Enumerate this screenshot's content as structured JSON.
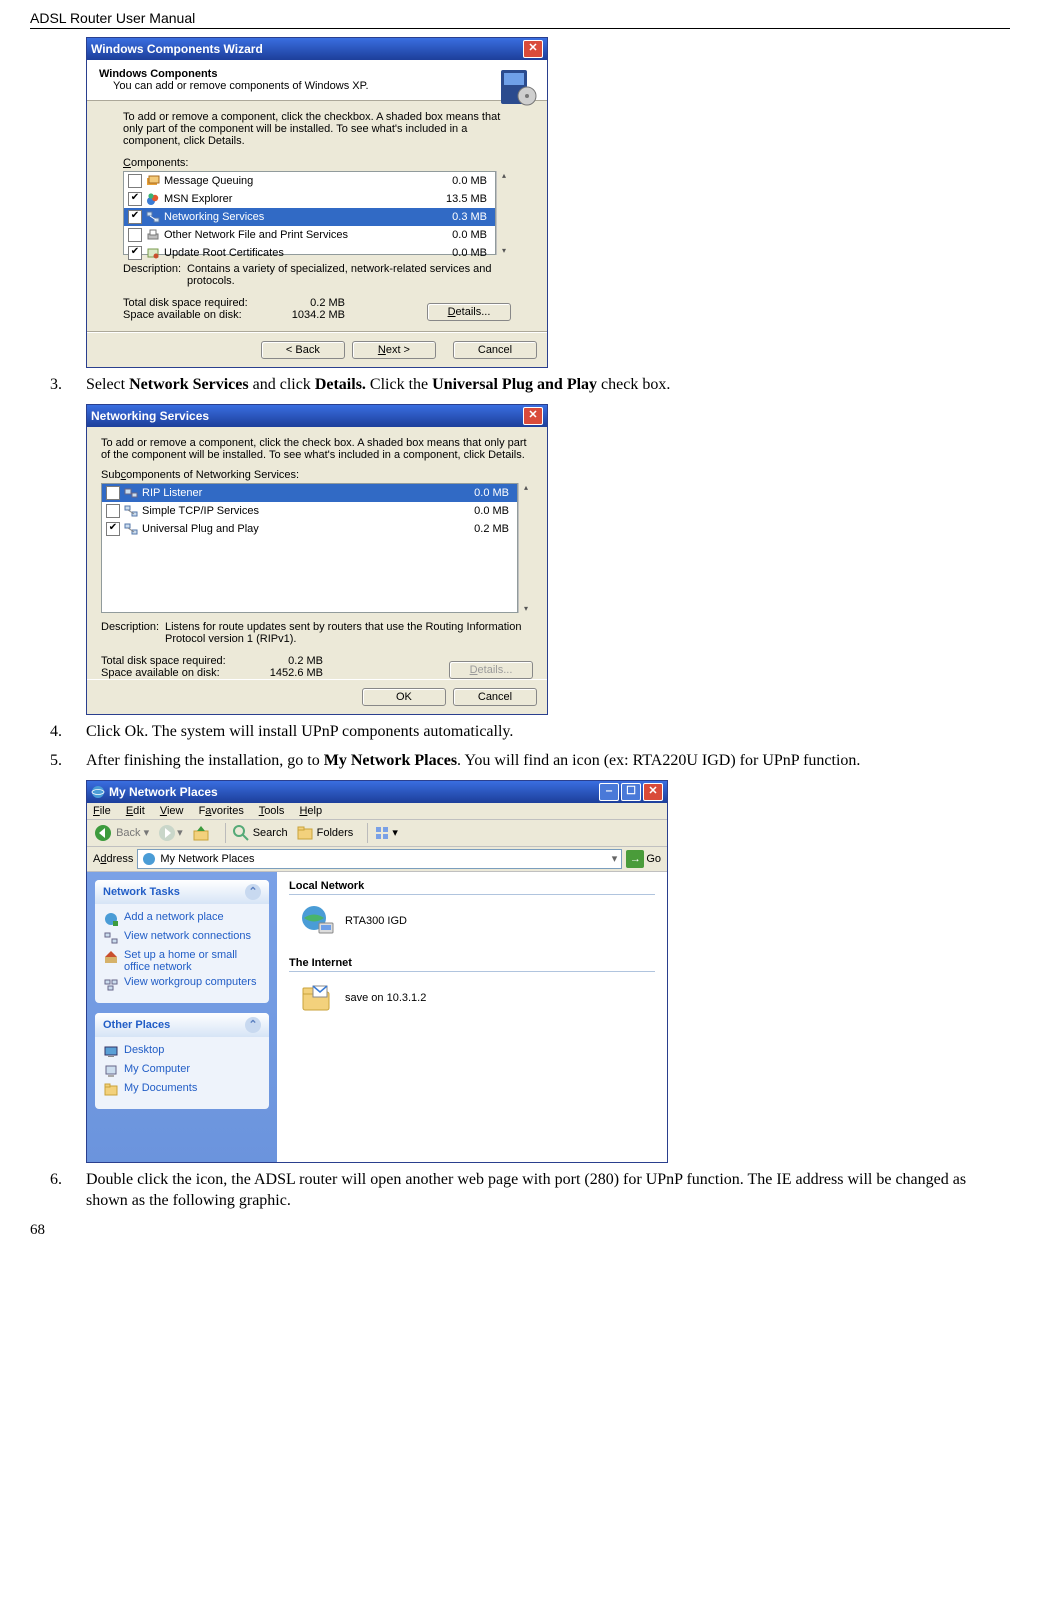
{
  "header": "ADSL Router User Manual",
  "page_number": "68",
  "steps": {
    "s3": {
      "num": "3.",
      "pre": "Select ",
      "b1": "Network Services",
      "mid": " and click ",
      "b2": "Details.",
      "post1": " Click the ",
      "b3": "Universal Plug and Play",
      "post2": " check box."
    },
    "s4": {
      "num": "4.",
      "text": "Click Ok. The system will install UPnP components automatically."
    },
    "s5": {
      "num": "5.",
      "pre": "After finishing the installation, go to ",
      "b1": "My Network Places",
      "post": ". You will find an icon (ex: RTA220U IGD) for UPnP function."
    },
    "s6": {
      "num": "6.",
      "text": "Double click the icon, the ADSL router will open another web page with port (280) for UPnP function. The IE address will be changed as shown as the following graphic."
    }
  },
  "wiz1": {
    "title": "Windows Components Wizard",
    "head_title": "Windows Components",
    "head_sub": "You can add or remove components of Windows XP.",
    "instr": "To add or remove a component, click the checkbox. A shaded box means that only part of the component will be installed. To see what's included in a component, click Details.",
    "components_label": "Components:",
    "rows": [
      {
        "checked": false,
        "label": "Message Queuing",
        "size": "0.0 MB",
        "icon": "msgq"
      },
      {
        "checked": true,
        "label": "MSN Explorer",
        "size": "13.5 MB",
        "icon": "msn"
      },
      {
        "checked": true,
        "label": "Networking Services",
        "size": "0.3 MB",
        "icon": "net",
        "selected": true
      },
      {
        "checked": false,
        "label": "Other Network File and Print Services",
        "size": "0.0 MB",
        "icon": "print"
      },
      {
        "checked": true,
        "label": "Update Root Certificates",
        "size": "0.0 MB",
        "icon": "cert"
      }
    ],
    "desc_label": "Description:",
    "desc_text": "Contains a variety of specialized, network-related services and protocols.",
    "totals": {
      "req_label": "Total disk space required:",
      "req_val": "0.2 MB",
      "avail_label": "Space available on disk:",
      "avail_val": "1034.2 MB"
    },
    "buttons": {
      "details": "Details...",
      "back": "< Back",
      "next": "Next >",
      "cancel": "Cancel"
    }
  },
  "wiz2": {
    "title": "Networking Services",
    "instr": "To add or remove a component, click the check box. A shaded box means that only part of the component will be installed. To see what's included in a component, click Details.",
    "sub_label": "Subcomponents of Networking Services:",
    "rows": [
      {
        "checked": false,
        "label": "RIP Listener",
        "size": "0.0 MB",
        "selected": true
      },
      {
        "checked": false,
        "label": "Simple TCP/IP Services",
        "size": "0.0 MB"
      },
      {
        "checked": true,
        "label": "Universal Plug and Play",
        "size": "0.2 MB"
      }
    ],
    "desc_label": "Description:",
    "desc_text": "Listens for route updates sent by routers that use the Routing Information Protocol version 1 (RIPv1).",
    "totals": {
      "req_label": "Total disk space required:",
      "req_val": "0.2 MB",
      "avail_label": "Space available on disk:",
      "avail_val": "1452.6 MB"
    },
    "buttons": {
      "details": "Details...",
      "ok": "OK",
      "cancel": "Cancel"
    }
  },
  "explorer": {
    "title": "My Network Places",
    "menus": {
      "file": "File",
      "edit": "Edit",
      "view": "View",
      "favorites": "Favorites",
      "tools": "Tools",
      "help": "Help"
    },
    "toolbar": {
      "back": "Back",
      "search": "Search",
      "folders": "Folders"
    },
    "address_label": "Address",
    "address_value": "My Network Places",
    "go_label": "Go",
    "panel_network": {
      "title": "Network Tasks",
      "items": [
        "Add a network place",
        "View network connections",
        "Set up a home or small office network",
        "View workgroup computers"
      ]
    },
    "panel_other": {
      "title": "Other Places",
      "items": [
        "Desktop",
        "My Computer",
        "My Documents"
      ]
    },
    "group1": {
      "title": "Local Network",
      "item": "RTA300   IGD"
    },
    "group2": {
      "title": "The Internet",
      "item": "save on 10.3.1.2"
    }
  }
}
